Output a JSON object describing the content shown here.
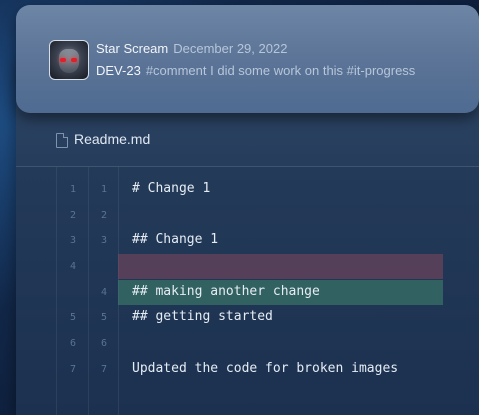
{
  "notification": {
    "user": "Star Scream",
    "date": "December 29, 2022",
    "issue": "DEV-23",
    "message": "#comment I did some work on this #it-progress"
  },
  "file": {
    "name": "Readme.md",
    "icon": "file-icon"
  },
  "diff": {
    "colors": {
      "deleted": "#8a4b5f",
      "added": "#3f8a6a"
    },
    "rows": [
      {
        "old": "1",
        "new": "1",
        "text": "# Change 1",
        "type": "context"
      },
      {
        "old": "2",
        "new": "2",
        "text": "",
        "type": "context"
      },
      {
        "old": "3",
        "new": "3",
        "text": "## Change 1",
        "type": "context"
      },
      {
        "old": "4",
        "new": "",
        "text": "",
        "type": "deleted"
      },
      {
        "old": "",
        "new": "4",
        "text": "## making another change",
        "type": "added"
      },
      {
        "old": "5",
        "new": "5",
        "text": "## getting started",
        "type": "context"
      },
      {
        "old": "6",
        "new": "6",
        "text": "",
        "type": "context"
      },
      {
        "old": "7",
        "new": "7",
        "text": "Updated the code for broken images",
        "type": "context"
      }
    ]
  }
}
